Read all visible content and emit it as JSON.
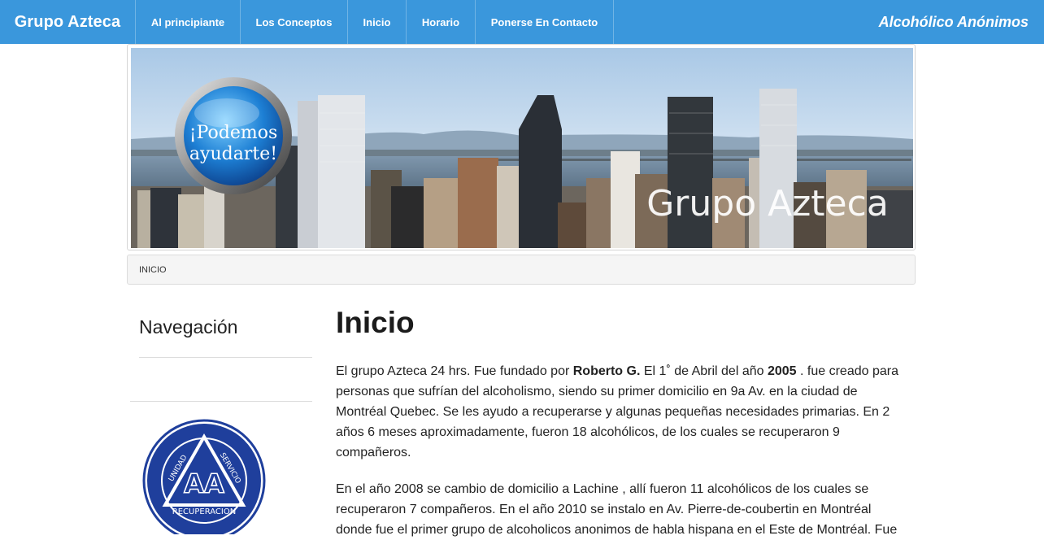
{
  "navbar": {
    "brand": "Grupo Azteca",
    "items": [
      {
        "label": "Al principiante"
      },
      {
        "label": "Los Conceptos"
      },
      {
        "label": "Inicio"
      },
      {
        "label": "Horario"
      },
      {
        "label": "Ponerse En Contacto"
      }
    ],
    "right_text": "Alcohólico Anónimos"
  },
  "banner": {
    "badge_line1": "¡Podemos",
    "badge_line2": "ayudarte!",
    "overlay_text": "Grupo Azteca"
  },
  "breadcrumb": {
    "current": "INICIO"
  },
  "sidebar": {
    "title": "Navegación",
    "logo": {
      "center_text": "AA",
      "left_text": "UNIDAD",
      "right_text": "SERVICIO",
      "bottom_text": "RECUPERACION"
    }
  },
  "main": {
    "title": "Inicio",
    "p1": {
      "t1": "El grupo Azteca 24 hrs. Fue fundado por ",
      "b1": "Roberto G.",
      "t2": " El 1˚ de Abril del año ",
      "b2": "2005",
      "t3": " . fue creado para personas  que sufrían del alcoholismo, siendo su primer domicilio en 9a Av. en la ciudad de Montréal Quebec. Se les ayudo a recuperarse y algunas pequeñas necesidades primarias. En 2 años 6 meses aproximadamente,  fueron 18 alcohólicos, de los cuales se recuperaron 9 compañeros."
    },
    "p2": "En el año 2008 se cambio de domicilio a Lachine , allí fueron 11 alcohólicos de los cuales se recuperaron  7 compañeros. En el año 2010 se instalo en Av. Pierre-de-coubertin  en Montréal donde fue el primer grupo de alcoholicos anonimos de habla hispana en el Este de Montréal. Fue"
  },
  "colors": {
    "navbar_bg": "#3a97dc",
    "aa_logo_blue": "#1f3f9c"
  }
}
